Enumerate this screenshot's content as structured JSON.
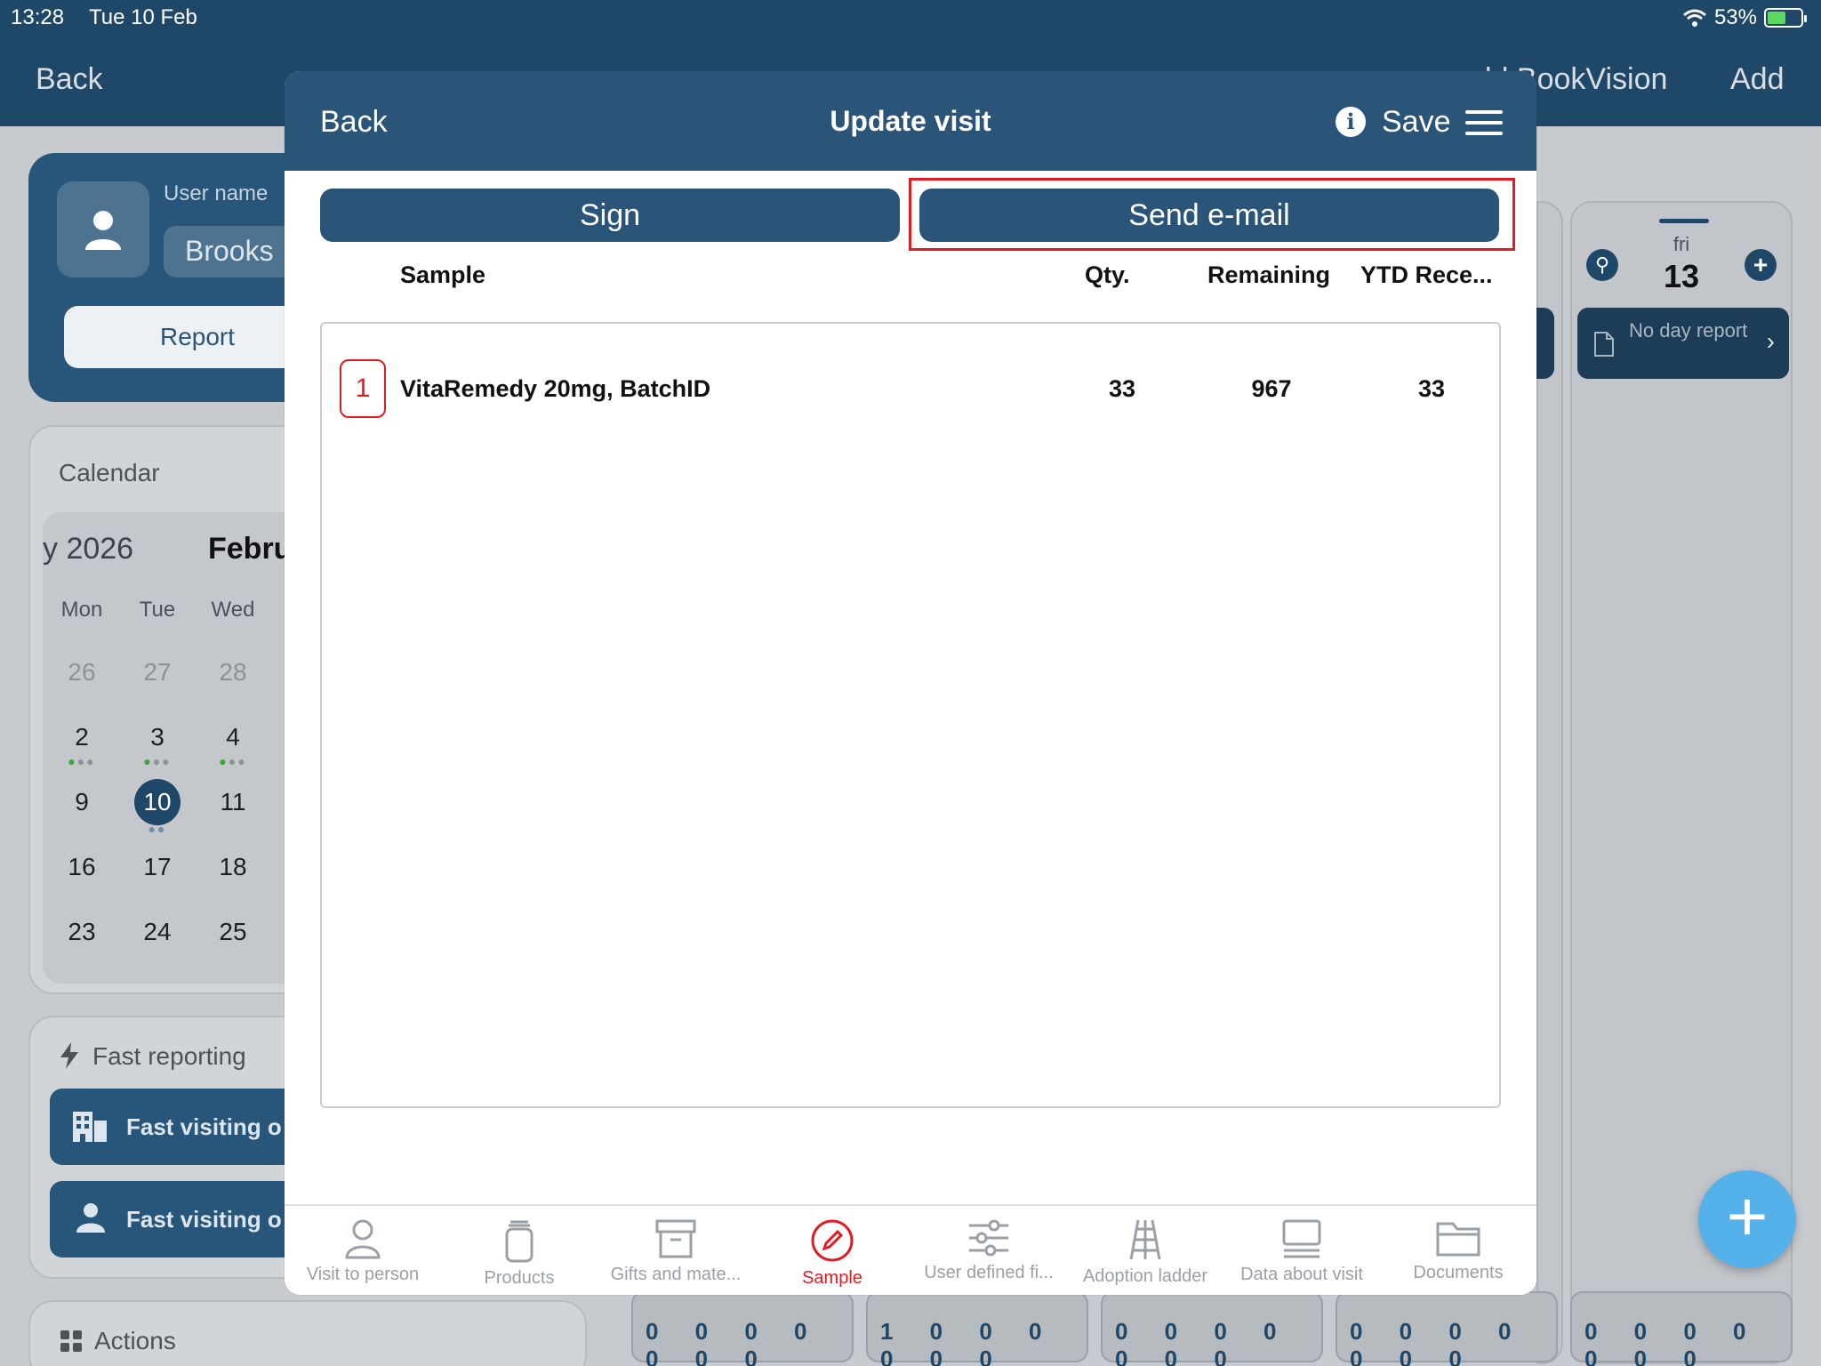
{
  "status": {
    "time": "13:28",
    "date": "Tue 10 Feb",
    "battery": "53%"
  },
  "bg": {
    "nav": {
      "back": "Back",
      "bookvision": "ld BookVision",
      "add": "Add"
    },
    "user": {
      "label": "User name",
      "name": "Brooks",
      "report": "Report"
    },
    "calendar": {
      "title": "Calendar",
      "year": "y 2026",
      "month": "Febru",
      "dow": [
        "Mon",
        "Tue",
        "Wed"
      ],
      "weeks": [
        [
          "26",
          "27",
          "28"
        ],
        [
          "2",
          "3",
          "4"
        ],
        [
          "9",
          "10",
          "11"
        ],
        [
          "16",
          "17",
          "18"
        ],
        [
          "23",
          "24",
          "25"
        ]
      ],
      "today": "10"
    },
    "fast": {
      "title": "Fast reporting",
      "org": "Fast visiting o",
      "person": "Fast visiting o"
    },
    "actions": {
      "title": "Actions"
    },
    "day": {
      "dow": "fri",
      "num": "13",
      "no_report": "No day report"
    },
    "strips": [
      "0 0 0 0 0 0 0",
      "1 0 0 0 0 0 0",
      "0 0 0 0 0 0 0",
      "0 0 0 0 0 0 0",
      "0 0 0 0 0 0 0"
    ]
  },
  "modal": {
    "back": "Back",
    "title": "Update visit",
    "save": "Save",
    "sign": "Sign",
    "send_email": "Send e-mail",
    "columns": {
      "sample": "Sample",
      "qty": "Qty.",
      "remaining": "Remaining",
      "ytd": "YTD Rece..."
    },
    "rows": [
      {
        "index": "1",
        "sample": "VitaRemedy 20mg, BatchID",
        "qty": "33",
        "remaining": "967",
        "ytd": "33"
      }
    ],
    "tabs": [
      {
        "label": "Visit to person",
        "icon": "person-icon"
      },
      {
        "label": "Products",
        "icon": "jar-icon"
      },
      {
        "label": "Gifts and mate...",
        "icon": "archive-box-icon"
      },
      {
        "label": "Sample",
        "icon": "sample-pen-icon",
        "active": true
      },
      {
        "label": "User defined fi...",
        "icon": "sliders-icon"
      },
      {
        "label": "Adoption ladder",
        "icon": "ladder-icon"
      },
      {
        "label": "Data about visit",
        "icon": "monitor-icon"
      },
      {
        "label": "Documents",
        "icon": "folder-icon"
      }
    ]
  },
  "colors": {
    "header": "#2a5478",
    "accent_red": "#e11b22",
    "fab": "#55b1e9"
  }
}
